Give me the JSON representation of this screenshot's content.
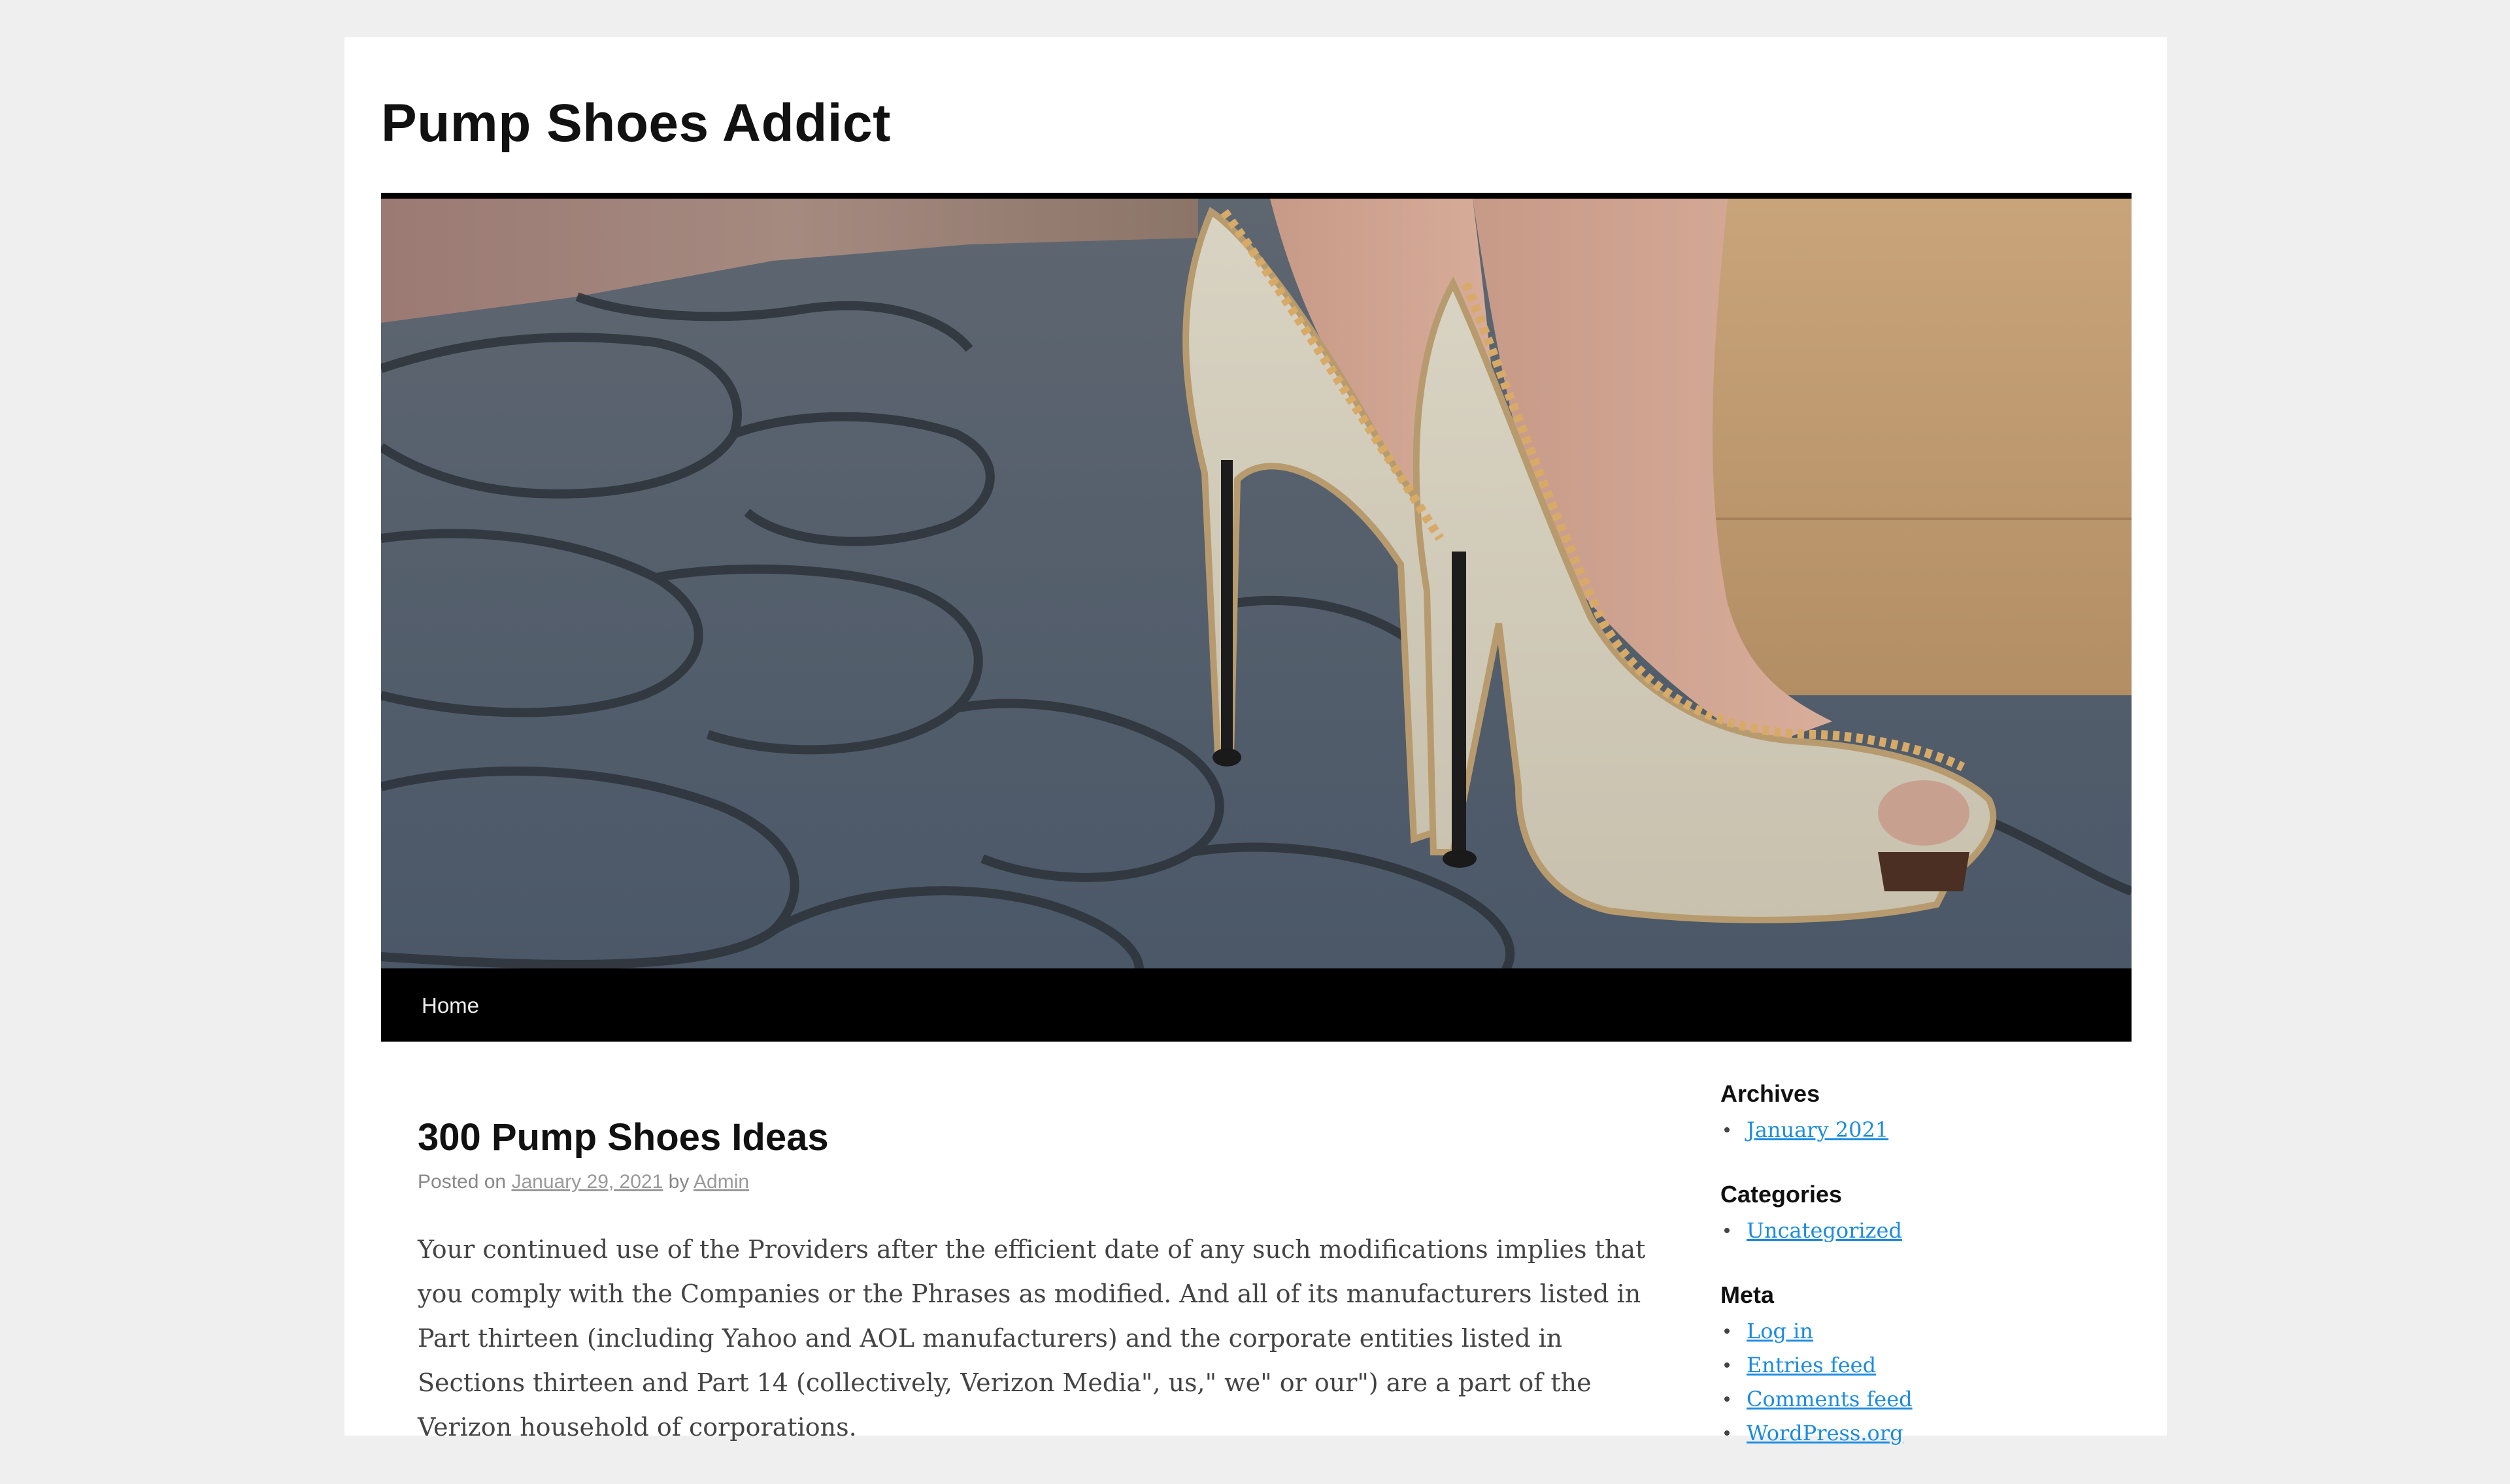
{
  "site": {
    "title": "Pump Shoes Addict"
  },
  "nav": {
    "items": [
      {
        "label": "Home"
      }
    ]
  },
  "post": {
    "title": "300 Pump Shoes Ideas",
    "meta": {
      "posted_on_label": "Posted on",
      "date": "January 29, 2021",
      "by_label": "by",
      "author": "Admin"
    },
    "body": "Your continued use of the Providers after the efficient date of any such modifications implies that you comply with the Companies or the Phrases as modified. And all of its manufacturers listed in Part thirteen (including Yahoo and AOL manufacturers) and the corporate entities listed in Sections thirteen and Part 14 (collectively, Verizon Media\", us,\" we\" or our\") are a part of the Verizon household of corporations."
  },
  "sidebar": {
    "archives": {
      "title": "Archives",
      "items": [
        "January 2021"
      ]
    },
    "categories": {
      "title": "Categories",
      "items": [
        "Uncategorized"
      ]
    },
    "meta": {
      "title": "Meta",
      "items": [
        "Log in",
        "Entries feed",
        "Comments feed",
        "WordPress.org"
      ]
    }
  },
  "colors": {
    "link": "#1b8be0",
    "nav_bar": "#000000",
    "page_bg": "#efefef"
  }
}
